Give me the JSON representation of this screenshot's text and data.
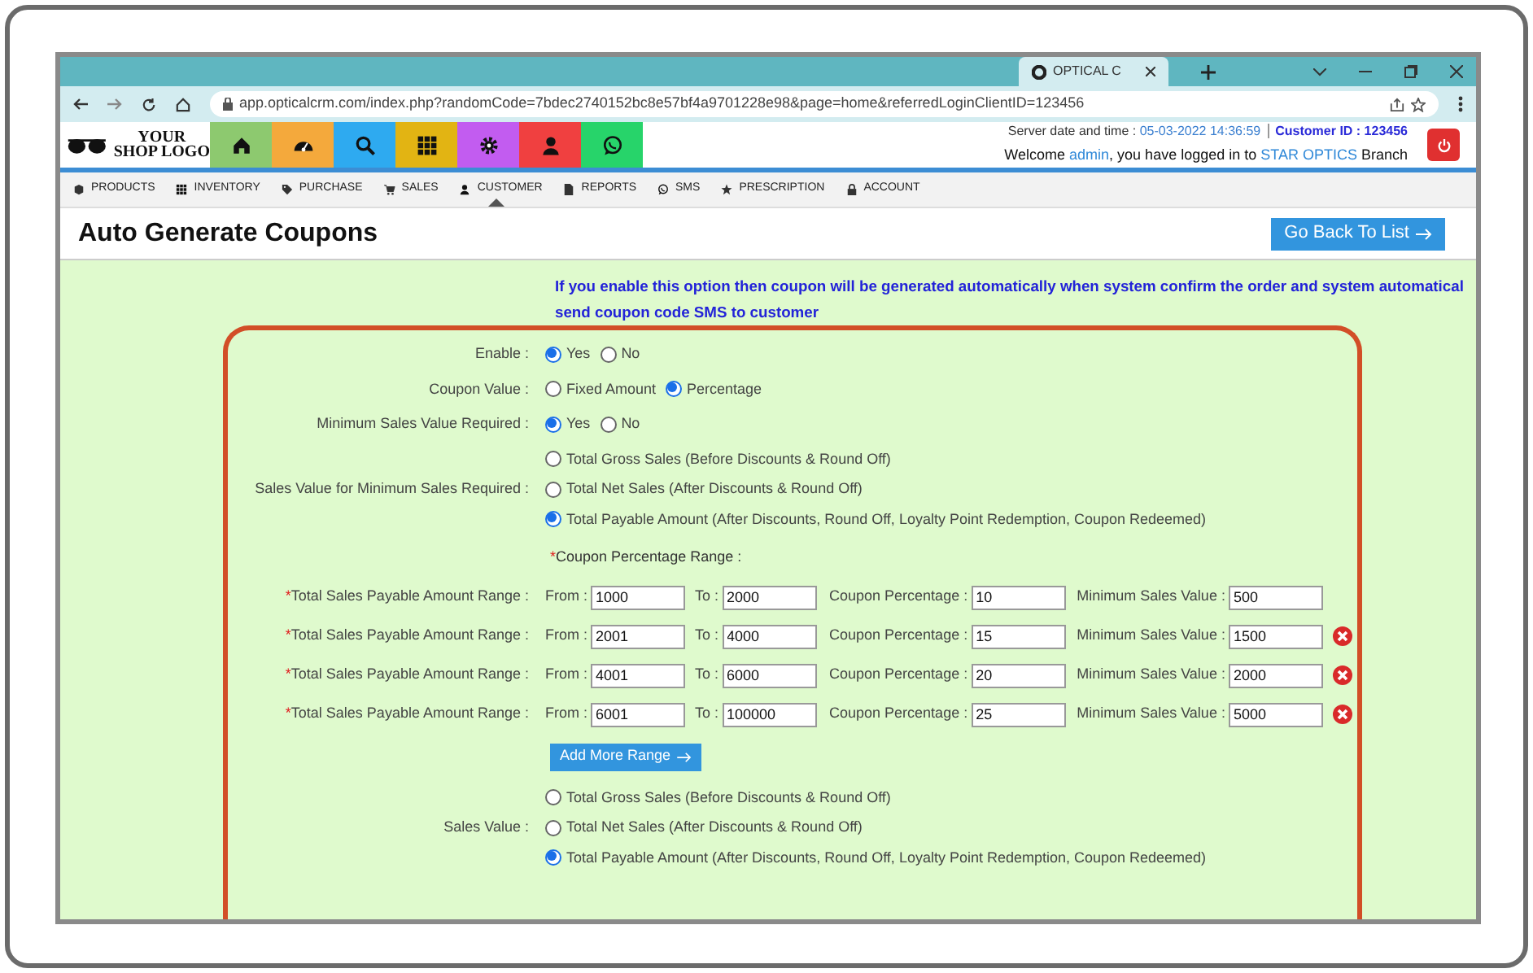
{
  "browser": {
    "tab_title": "OPTICAL C",
    "url": "app.opticalcrm.com/index.php?randomCode=7bdec2740152bc8e57bf4a9701228e98&page=home&referredLoginClientID=123456"
  },
  "header": {
    "logo": [
      "YOUR",
      "SHOP LOGO"
    ],
    "quick_buttons": [
      {
        "color": "#8dc96f"
      },
      {
        "color": "#f4a93c"
      },
      {
        "color": "#2eaaf0"
      },
      {
        "color": "#e2b413"
      },
      {
        "color": "#c25cf0"
      },
      {
        "color": "#f04040"
      },
      {
        "color": "#27d46a"
      }
    ],
    "server_label": "Server date and time :",
    "server_time": "05-03-2022 14:36:59",
    "customer_id": "Customer ID : 123456",
    "welcome": [
      "Welcome ",
      "admin",
      ", you have logged in to ",
      "STAR OPTICS",
      " Branch"
    ]
  },
  "menu": [
    {
      "label": "PRODUCTS",
      "selected": false
    },
    {
      "label": "INVENTORY",
      "selected": false
    },
    {
      "label": "PURCHASE",
      "selected": false
    },
    {
      "label": "SALES",
      "selected": false
    },
    {
      "label": "CUSTOMER",
      "selected": true
    },
    {
      "label": "REPORTS",
      "selected": false
    },
    {
      "label": "SMS",
      "selected": false
    },
    {
      "label": "PRESCRIPTION",
      "selected": false
    },
    {
      "label": "ACCOUNT",
      "selected": false
    }
  ],
  "page_title": "Auto Generate Coupons",
  "back_button": "Go Back To List",
  "info": "If you enable this option then coupon will be generated automatically when system confirm the order and system automatical send coupon code SMS to customer",
  "groups_top": [
    {
      "label": "Enable :",
      "kind": "inline",
      "options": [
        {
          "label": "Yes",
          "selected": true
        },
        {
          "label": "No",
          "selected": false
        }
      ]
    },
    {
      "label": "Coupon Value :",
      "kind": "inline",
      "options": [
        {
          "label": "Fixed Amount",
          "selected": false
        },
        {
          "label": "Percentage",
          "selected": true
        }
      ]
    },
    {
      "label": "Minimum Sales Value Required :",
      "kind": "inline",
      "options": [
        {
          "label": "Yes",
          "selected": true
        },
        {
          "label": "No",
          "selected": false
        }
      ]
    },
    {
      "label": "Sales Value for Minimum Sales Required :",
      "kind": "stacked",
      "options": [
        {
          "label": "Total Gross Sales (Before Discounts & Round Off)",
          "selected": false
        },
        {
          "label": "Total Net Sales (After Discounts & Round Off)",
          "selected": false
        },
        {
          "label": "Total Payable Amount (After Discounts, Round Off, Loyalty Point Redemption, Coupon Redeemed)",
          "selected": true
        }
      ]
    }
  ],
  "range_heading": {
    "mark": "*",
    "text": "Coupon Percentage Range :"
  },
  "ranges": [
    {
      "mark": "*",
      "label": "Total Sales Payable Amount Range :",
      "from_label": "From :",
      "from": "1000",
      "to_label": "To :",
      "to": "2000",
      "pct_label": "Coupon Percentage :",
      "pct": "10",
      "min_label": "Minimum Sales Value :",
      "min": "500",
      "removable": false
    },
    {
      "mark": "*",
      "label": "Total Sales Payable Amount Range :",
      "from_label": "From :",
      "from": "2001",
      "to_label": "To :",
      "to": "4000",
      "pct_label": "Coupon Percentage :",
      "pct": "15",
      "min_label": "Minimum Sales Value :",
      "min": "1500",
      "removable": true
    },
    {
      "mark": "*",
      "label": "Total Sales Payable Amount Range :",
      "from_label": "From :",
      "from": "4001",
      "to_label": "To :",
      "to": "6000",
      "pct_label": "Coupon Percentage :",
      "pct": "20",
      "min_label": "Minimum Sales Value :",
      "min": "2000",
      "removable": true
    },
    {
      "mark": "*",
      "label": "Total Sales Payable Amount Range :",
      "from_label": "From :",
      "from": "6001",
      "to_label": "To :",
      "to": "100000",
      "pct_label": "Coupon Percentage :",
      "pct": "25",
      "min_label": "Minimum Sales Value :",
      "min": "5000",
      "removable": true
    }
  ],
  "add_button": "Add More Range",
  "groups_bottom": [
    {
      "label": "Sales Value :",
      "kind": "stacked",
      "options": [
        {
          "label": "Total Gross Sales (Before Discounts & Round Off)",
          "selected": false
        },
        {
          "label": "Total Net Sales (After Discounts & Round Off)",
          "selected": false
        },
        {
          "label": "Total Payable Amount (After Discounts, Round Off, Loyalty Point Redemption, Coupon Redeemed)",
          "selected": true
        }
      ]
    }
  ]
}
